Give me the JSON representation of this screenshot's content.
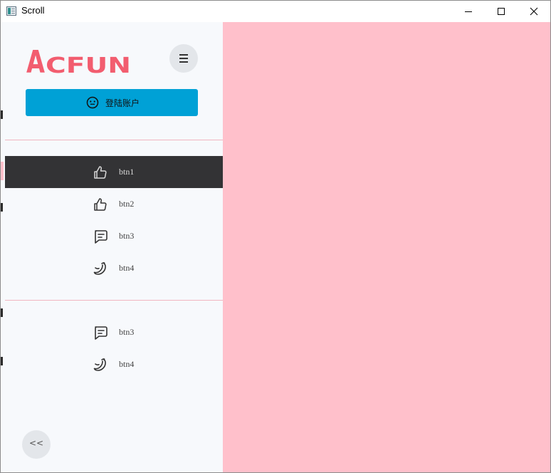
{
  "window": {
    "title": "Scroll"
  },
  "sidebar": {
    "logo_text": "ACFUN",
    "login_label": "登陆账户",
    "collapse_label": "<<",
    "groups": [
      {
        "items": [
          {
            "label": "btn1",
            "icon": "thumbs-up-icon",
            "active": true
          },
          {
            "label": "btn2",
            "icon": "thumbs-up-icon",
            "active": false
          },
          {
            "label": "btn3",
            "icon": "chat-message-icon",
            "active": false
          },
          {
            "label": "btn4",
            "icon": "banana-icon",
            "active": false
          }
        ]
      },
      {
        "items": [
          {
            "label": "btn3",
            "icon": "chat-message-icon",
            "active": false
          },
          {
            "label": "btn4",
            "icon": "banana-icon",
            "active": false
          }
        ]
      }
    ]
  },
  "colors": {
    "sidebar_bg": "#f7f9fc",
    "content_bg": "#ffc0cb",
    "login_button": "#00a1d6",
    "active_item": "#333335",
    "logo": "#f25d6f",
    "divider": "#f0b6c0"
  }
}
